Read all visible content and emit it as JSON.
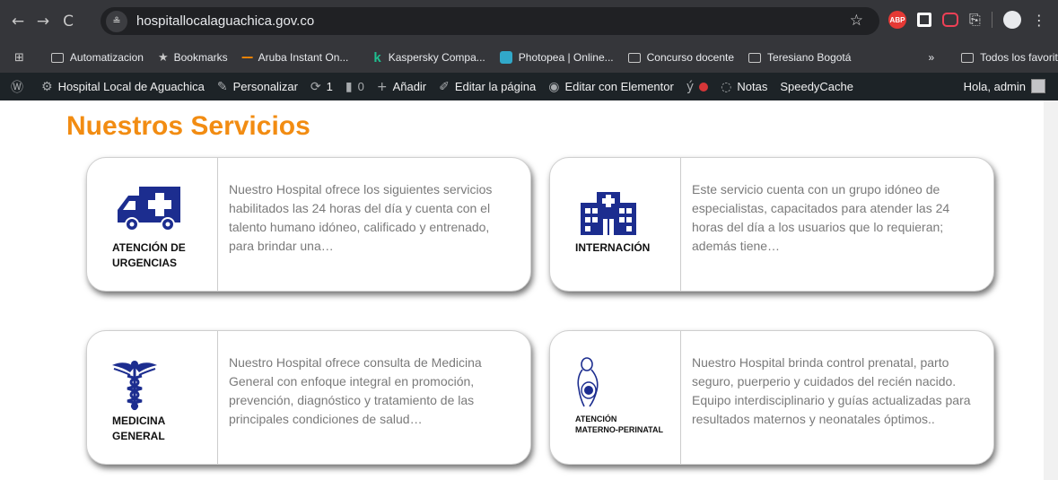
{
  "browser": {
    "nav": {
      "back": "←",
      "forward": "→",
      "reload": "C"
    },
    "site_icon": "≗",
    "url": "hospitallocalaguachica.gov.co",
    "star": "☆",
    "extensions": {
      "abp": "ABP",
      "puzzle": "⎘",
      "menu": "⋮"
    }
  },
  "bookmarks": {
    "apps_icon": "⊞",
    "items": [
      "Automatizacion",
      "Bookmarks",
      "Aruba Instant On...",
      "Kaspersky Compa...",
      "Photopea | Online...",
      "Concurso docente",
      "Teresiano Bogotá"
    ],
    "more": "»",
    "all_bookmarks": "Todos los favorito"
  },
  "adminbar": {
    "wp_icon": "Ⓦ",
    "site_name": "Hospital Local de Aguachica",
    "customize": "Personalizar",
    "updates_count": "1",
    "comments_count": "0",
    "add_new": "Añadir",
    "edit_page": "Editar la página",
    "elementor": "Editar con Elementor",
    "notes": "Notas",
    "speedycache": "SpeedyCache",
    "greeting": "Hola, admin"
  },
  "page": {
    "heading": "Nuestros Servicios",
    "services": [
      {
        "title_line1": "ATENCIÓN DE",
        "title_line2": "URGENCIAS",
        "icon": "ambulance-icon",
        "text": "Nuestro Hospital ofrece los siguientes servicios habilitados las 24 horas del día y cuenta con el talento humano idóneo, calificado y entrenado, para brindar una…"
      },
      {
        "title_line1": "INTERNACIÓN",
        "title_line2": "",
        "icon": "hospital-building-icon",
        "text": "Este servicio  cuenta con un grupo idóneo de especialistas, capacitados para atender las 24 horas del día a los usuarios que lo requieran; además tiene…"
      },
      {
        "title_line1": "MEDICINA",
        "title_line2": "GENERAL",
        "icon": "caduceus-icon",
        "text": "Nuestro Hospital ofrece consulta de Medicina General con enfoque integral en promoción, prevención, diagnóstico y tratamiento de las principales condiciones de salud…"
      },
      {
        "title_line1": "ATENCIÓN",
        "title_line2": "MATERNO-PERINATAL",
        "icon": "pregnant-woman-icon",
        "text": "Nuestro Hospital brinda control prenatal, parto seguro, puerperio y cuidados del recién nacido. Equipo interdisciplinario y guías actualizadas para resultados maternos y neonatales óptimos.."
      }
    ]
  },
  "colors": {
    "heading": "#f28c12",
    "icon_blue": "#1c2d8f",
    "browser_bar": "#35363a",
    "admin_bar": "#1d2327"
  }
}
